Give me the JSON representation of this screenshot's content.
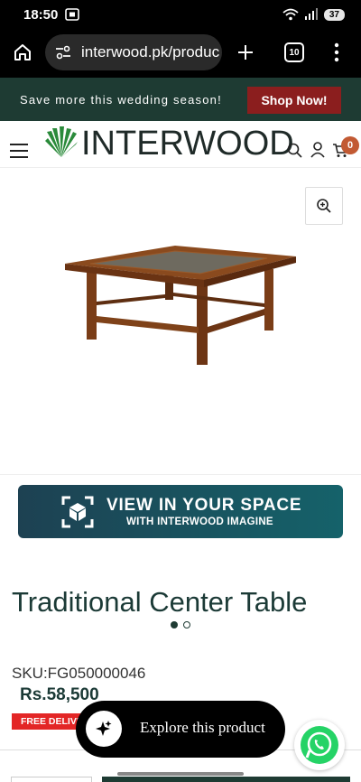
{
  "status_bar": {
    "time": "18:50",
    "battery": "37"
  },
  "browser": {
    "url": "interwood.pk/produc",
    "tab_count": "10"
  },
  "promo": {
    "text": "Save more this wedding season!",
    "cta": "Shop Now!"
  },
  "header": {
    "logo_text": "INTERWOOD",
    "cart_count": "0"
  },
  "gallery": {
    "active_slide": 1,
    "slide_count": 2
  },
  "view_in_space": {
    "title": "VIEW IN YOUR SPACE",
    "subtitle": "WITH INTERWOOD IMAGINE"
  },
  "product": {
    "title": "Traditional Center Table",
    "sku": "SKU:FG050000046",
    "price": "Rs.58,500",
    "badge": "FREE DELIVERY"
  },
  "explore": {
    "label": "Explore this product"
  },
  "colors": {
    "brand_dark": "#1e3b33",
    "cta_red": "#8b1e1e",
    "accent_orange": "#c25a33",
    "badge_red": "#e32626",
    "whatsapp": "#25d366"
  }
}
